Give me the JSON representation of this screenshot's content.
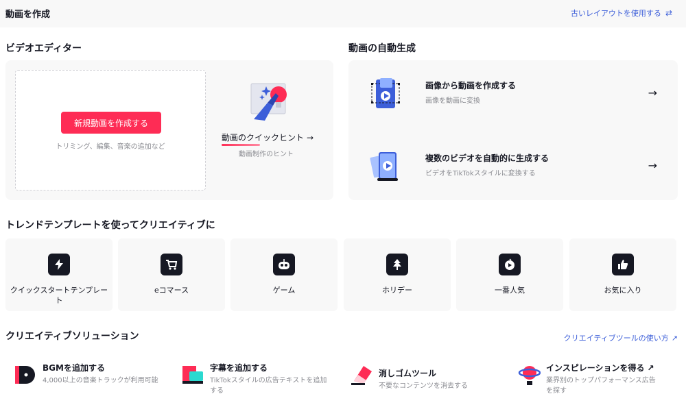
{
  "topbar": {
    "title": "動画を作成",
    "old_layout_label": "古いレイアウトを使用する"
  },
  "video_editor": {
    "title": "ビデオエディター",
    "new_video_label": "新規動画を作成する",
    "hint": "トリミング、編集、音楽の追加など",
    "quick_hint_title": "動画のクイックヒント",
    "quick_hint_sub": "動画制作のヒント"
  },
  "auto_gen": {
    "title": "動画の自動生成",
    "items": [
      {
        "title": "画像から動画を作成する",
        "sub": "画像を動画に変換"
      },
      {
        "title": "複数のビデオを自動的に生成する",
        "sub": "ビデオをTikTokスタイルに変換する"
      }
    ]
  },
  "templates": {
    "title": "トレンドテンプレートを使ってクリエイティブに",
    "items": [
      {
        "label": "クイックスタートテンプレート",
        "icon": "lightning-icon"
      },
      {
        "label": "eコマース",
        "icon": "cart-icon"
      },
      {
        "label": "ゲーム",
        "icon": "game-icon"
      },
      {
        "label": "ホリデー",
        "icon": "tree-icon"
      },
      {
        "label": "一番人気",
        "icon": "trending-icon"
      },
      {
        "label": "お気に入り",
        "icon": "thumbs-up-icon"
      }
    ]
  },
  "solutions": {
    "title": "クリエイティブソリューション",
    "link_label": "クリエイティブツールの使い方",
    "items": [
      {
        "title": "BGMを追加する",
        "sub": "4,000以上の音楽トラックが利用可能"
      },
      {
        "title": "字幕を追加する",
        "sub": "TikTokスタイルの広告テキストを追加する"
      },
      {
        "title": "消しゴムツール",
        "sub": "不要なコンテンツを消去する"
      },
      {
        "title": "インスピレーションを得る",
        "sub": "業界別のトップパフォーマンス広告を探す"
      }
    ]
  },
  "colors": {
    "accent": "#fe2c55",
    "link": "#3d5fd9",
    "muted": "#8a8b91"
  }
}
